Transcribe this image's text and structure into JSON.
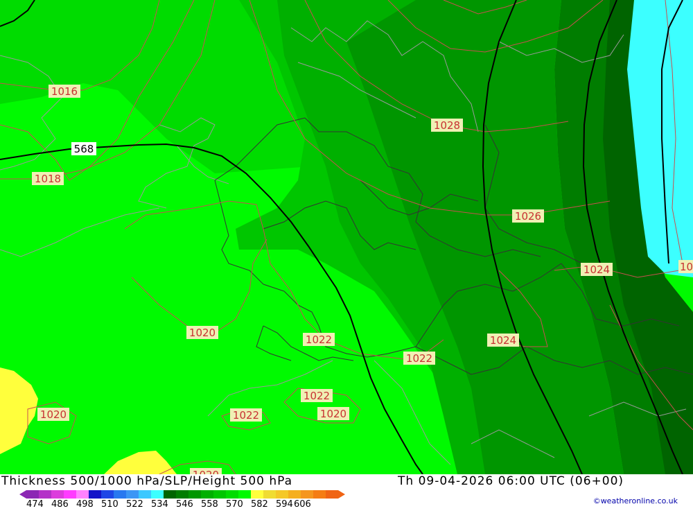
{
  "map": {
    "contour_labels": [
      "1016",
      "1018",
      "1020",
      "1020",
      "1022",
      "1022",
      "1022",
      "1022",
      "1024",
      "1024",
      "1026",
      "1028",
      "1020",
      "1020",
      "568",
      "1024",
      "10"
    ],
    "colors": {
      "bright_green": "#00fa00",
      "mid_green_1": "#00dc00",
      "mid_green_2": "#00c600",
      "mid_green_3": "#00b000",
      "dark_green_1": "#009600",
      "dark_green_2": "#007d00",
      "cyan": "#3cffff",
      "yellow": "#ffff3c",
      "isobar": "#c85050",
      "border": "#333333",
      "coast": "#9a9a9a",
      "height_line": "#000000"
    }
  },
  "footer": {
    "title": "Thickness 500/1000 hPa/SLP/Height 500 hPa",
    "datetime": "Th 09-04-2026 06:00 UTC (06+00)",
    "credit": "©weatheronline.co.uk",
    "legend_ticks": [
      "474",
      "486",
      "498",
      "510",
      "522",
      "534",
      "546",
      "558",
      "570",
      "582",
      "594",
      "606"
    ],
    "legend_colors": [
      "#8c28b4",
      "#b432c8",
      "#dc3cdc",
      "#ff3cff",
      "#ff82ff",
      "#1414c8",
      "#1e46e6",
      "#2878f0",
      "#3c96f5",
      "#3cc8ff",
      "#3cffff",
      "#006400",
      "#007d00",
      "#009600",
      "#00b000",
      "#00c600",
      "#00dc00",
      "#00fa00",
      "#ffff3c",
      "#f0dc32",
      "#f5c828",
      "#f5af1e",
      "#f5961e",
      "#f57d14",
      "#f06414"
    ]
  }
}
